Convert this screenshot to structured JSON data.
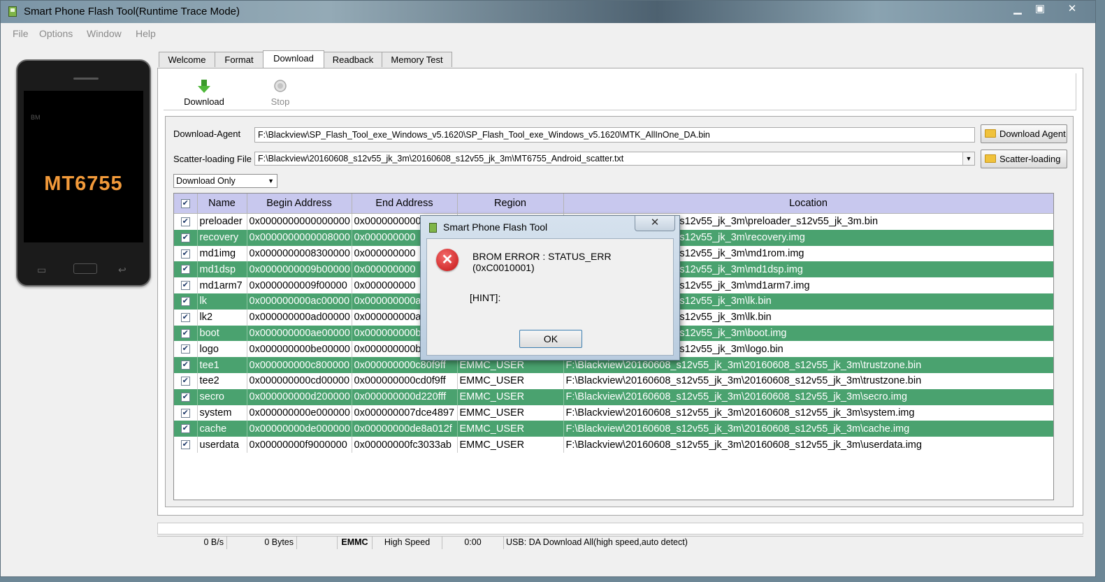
{
  "window": {
    "title": "Smart Phone Flash Tool(Runtime Trace Mode)",
    "minimize": "▁",
    "maximize": "▣",
    "close": "✕"
  },
  "menu": [
    "File",
    "Options",
    "Window",
    "Help"
  ],
  "phone": {
    "chip": "MT6755",
    "brand": "BM"
  },
  "tabs": [
    "Welcome",
    "Format",
    "Download",
    "Readback",
    "Memory Test"
  ],
  "active_tab": "Download",
  "toolbar": {
    "download": "Download",
    "stop": "Stop"
  },
  "download_agent": {
    "label": "Download-Agent",
    "value": "F:\\Blackview\\SP_Flash_Tool_exe_Windows_v5.1620\\SP_Flash_Tool_exe_Windows_v5.1620\\MTK_AllInOne_DA.bin",
    "button": "Download Agent"
  },
  "scatter": {
    "label": "Scatter-loading File",
    "value": "F:\\Blackview\\20160608_s12v55_jk_3m\\20160608_s12v55_jk_3m\\MT6755_Android_scatter.txt",
    "button": "Scatter-loading"
  },
  "mode_select": "Download Only",
  "table": {
    "headers": [
      "Name",
      "Begin Address",
      "End Address",
      "Region",
      "Location"
    ],
    "rows": [
      {
        "name": "preloader",
        "begin": "0x0000000000000000",
        "end": "0x00000000000",
        "region": "",
        "location": "12v55_jk_3m\\20160608_s12v55_jk_3m\\preloader_s12v55_jk_3m.bin"
      },
      {
        "name": "recovery",
        "begin": "0x0000000000008000",
        "end": "0x000000000",
        "region": "",
        "location": "12v55_jk_3m\\20160608_s12v55_jk_3m\\recovery.img"
      },
      {
        "name": "md1img",
        "begin": "0x0000000008300000",
        "end": "0x000000000",
        "region": "",
        "location": "12v55_jk_3m\\20160608_s12v55_jk_3m\\md1rom.img"
      },
      {
        "name": "md1dsp",
        "begin": "0x0000000009b00000",
        "end": "0x000000000",
        "region": "",
        "location": "12v55_jk_3m\\20160608_s12v55_jk_3m\\md1dsp.img"
      },
      {
        "name": "md1arm7",
        "begin": "0x0000000009f00000",
        "end": "0x000000000",
        "region": "",
        "location": "12v55_jk_3m\\20160608_s12v55_jk_3m\\md1arm7.img"
      },
      {
        "name": "lk",
        "begin": "0x000000000ac00000",
        "end": "0x000000000a",
        "region": "",
        "location": "12v55_jk_3m\\20160608_s12v55_jk_3m\\lk.bin"
      },
      {
        "name": "lk2",
        "begin": "0x000000000ad00000",
        "end": "0x000000000a",
        "region": "",
        "location": "12v55_jk_3m\\20160608_s12v55_jk_3m\\lk.bin"
      },
      {
        "name": "boot",
        "begin": "0x000000000ae00000",
        "end": "0x000000000b",
        "region": "",
        "location": "12v55_jk_3m\\20160608_s12v55_jk_3m\\boot.img"
      },
      {
        "name": "logo",
        "begin": "0x000000000be00000",
        "end": "0x000000000b",
        "region": "",
        "location": "12v55_jk_3m\\20160608_s12v55_jk_3m\\logo.bin"
      },
      {
        "name": "tee1",
        "begin": "0x000000000c800000",
        "end": "0x000000000c80f9ff",
        "region": "EMMC_USER",
        "location": "F:\\Blackview\\20160608_s12v55_jk_3m\\20160608_s12v55_jk_3m\\trustzone.bin"
      },
      {
        "name": "tee2",
        "begin": "0x000000000cd00000",
        "end": "0x000000000cd0f9ff",
        "region": "EMMC_USER",
        "location": "F:\\Blackview\\20160608_s12v55_jk_3m\\20160608_s12v55_jk_3m\\trustzone.bin"
      },
      {
        "name": "secro",
        "begin": "0x000000000d200000",
        "end": "0x000000000d220fff",
        "region": "EMMC_USER",
        "location": "F:\\Blackview\\20160608_s12v55_jk_3m\\20160608_s12v55_jk_3m\\secro.img"
      },
      {
        "name": "system",
        "begin": "0x000000000e000000",
        "end": "0x000000007dce4897",
        "region": "EMMC_USER",
        "location": "F:\\Blackview\\20160608_s12v55_jk_3m\\20160608_s12v55_jk_3m\\system.img"
      },
      {
        "name": "cache",
        "begin": "0x00000000de000000",
        "end": "0x00000000de8a012f",
        "region": "EMMC_USER",
        "location": "F:\\Blackview\\20160608_s12v55_jk_3m\\20160608_s12v55_jk_3m\\cache.img"
      },
      {
        "name": "userdata",
        "begin": "0x00000000f9000000",
        "end": "0x00000000fc3033ab",
        "region": "EMMC_USER",
        "location": "F:\\Blackview\\20160608_s12v55_jk_3m\\20160608_s12v55_jk_3m\\userdata.img"
      }
    ]
  },
  "status": {
    "speed": "0 B/s",
    "bytes": "0 Bytes",
    "storage": "EMMC",
    "mode": "High Speed",
    "time": "0:00",
    "info": "USB: DA Download All(high speed,auto detect)"
  },
  "dialog": {
    "title": "Smart Phone Flash Tool",
    "message": "BROM ERROR : STATUS_ERR (0xC0010001)",
    "hint": "[HINT]:",
    "ok": "OK",
    "close": "✕"
  },
  "colors": {
    "row_green": "#4aa26f",
    "header": "#c8c8ee",
    "chip_text": "#f29a3a"
  }
}
